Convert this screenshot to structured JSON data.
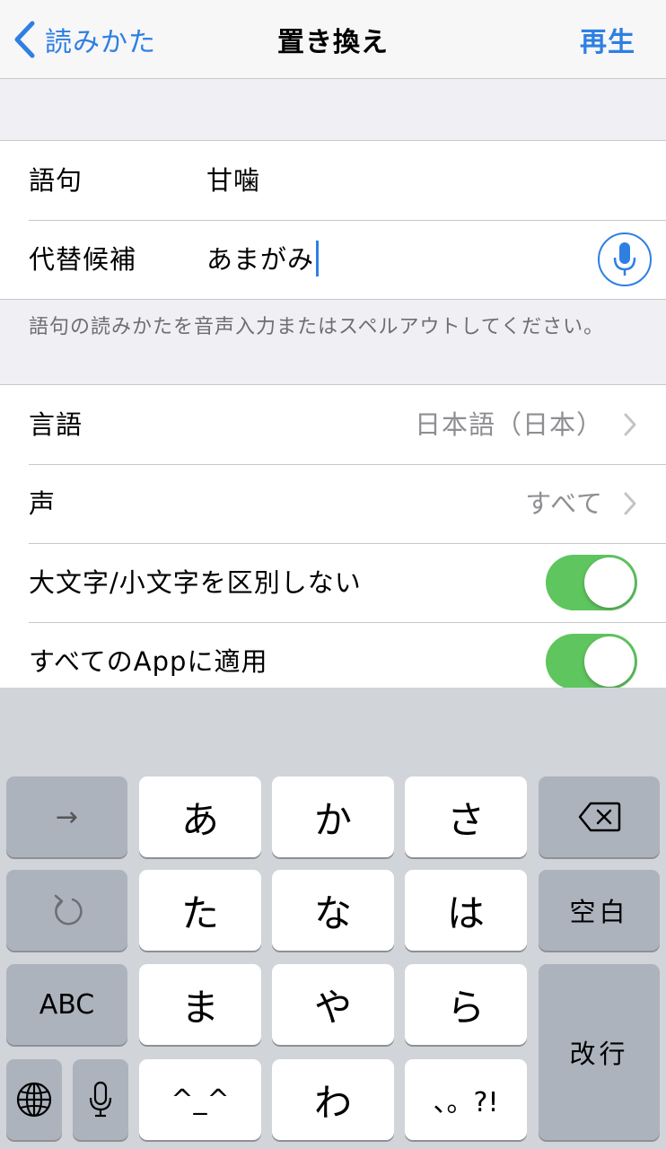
{
  "nav": {
    "back_label": "読みかた",
    "title": "置き換え",
    "play_label": "再生"
  },
  "entry": {
    "phrase_label": "語句",
    "phrase_value": "甘噛",
    "substitution_label": "代替候補",
    "substitution_value": "あまがみ",
    "footnote": "語句の読みかたを音声入力またはスペルアウトしてください。"
  },
  "settings": {
    "language_label": "言語",
    "language_value": "日本語（日本）",
    "voice_label": "声",
    "voice_value": "すべて",
    "case_insensitive_label": "大文字/小文字を区別しない",
    "case_insensitive_on": true,
    "apply_all_apps_label": "すべてのAppに適用",
    "apply_all_apps_on": true
  },
  "keyboard": {
    "next_key": "→",
    "kana_a": "あ",
    "kana_ka": "か",
    "kana_sa": "さ",
    "undo_icon": "undo-icon",
    "kana_ta": "た",
    "kana_na": "な",
    "kana_ha": "は",
    "space_key": "空白",
    "abc_key": "ABC",
    "kana_ma": "ま",
    "kana_ya": "や",
    "kana_ra": "ら",
    "return_key": "改行",
    "emoticon_key": "^_^",
    "kana_wa": "わ",
    "punct_key": "、。?!",
    "globe_icon": "globe-icon",
    "mic_icon": "microphone-icon",
    "delete_icon": "delete-backspace-icon"
  },
  "colors": {
    "accent": "#2f7fe3",
    "toggle_on": "#5fc55e",
    "key_dark": "#adb3bd",
    "keyboard_bg": "#d1d4d9"
  }
}
